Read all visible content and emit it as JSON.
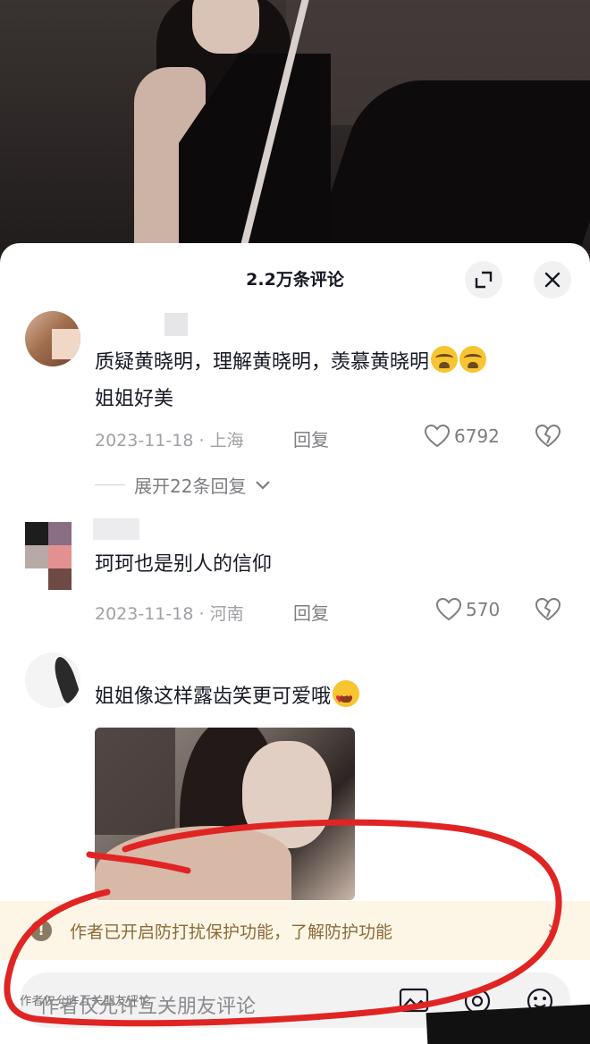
{
  "sheet": {
    "title": "2.2万条评论"
  },
  "comments": [
    {
      "text": "质疑黄晓明，理解黄晓明，羡慕黄晓明",
      "text_line2": "姐姐好美",
      "emojis": [
        "crying-emoji",
        "crying-emoji"
      ],
      "date": "2023-11-18",
      "location": "上海",
      "reply_label": "回复",
      "likes": "6792",
      "expand_replies": "展开22条回复"
    },
    {
      "text": "珂珂也是别人的信仰",
      "date": "2023-11-18",
      "location": "河南",
      "reply_label": "回复",
      "likes": "570"
    },
    {
      "text": "姐姐像这样露齿笑更可爱哦",
      "emojis": [
        "star-struck-emoji"
      ],
      "has_image": true
    }
  ],
  "notice": {
    "text": "作者已开启防打扰保护功能，了解防护功能",
    "icon": "warning-icon"
  },
  "input": {
    "placeholder": "作者仅允许互关朋友评论"
  },
  "colors": {
    "annotation_red": "#e02424",
    "notice_bg": "#fdf6e6",
    "notice_text": "#8a6a3a"
  }
}
